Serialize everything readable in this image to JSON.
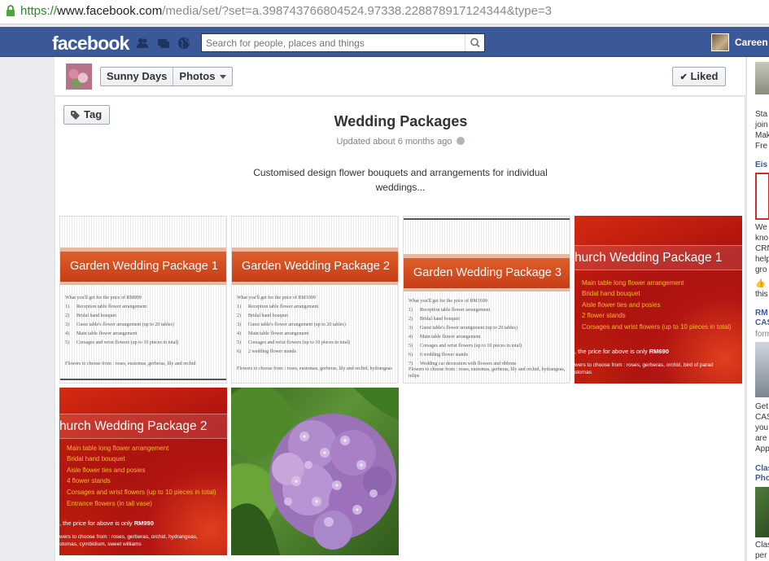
{
  "browser": {
    "url_https": "https://",
    "url_host": "www.facebook.com",
    "url_path": "/media/set/?set=a.398743766804524.97338.228878917124344&type=3"
  },
  "fb_header": {
    "logo": "facebook",
    "search_placeholder": "Search for people, places and things",
    "user_name": "Careen"
  },
  "page_strip": {
    "page_name": "Sunny Days",
    "section": "Photos",
    "liked_label": "Liked"
  },
  "album": {
    "tag_label": "Tag",
    "title": "Wedding Packages",
    "updated": "Updated about 6 months ago",
    "description": "Customised design flower bouquets and arrangements for individual weddings..."
  },
  "photos": {
    "garden1": {
      "title": "Garden Wedding Package 1",
      "intro": "What you'll get for the price of RM899",
      "items": [
        {
          "n": "1)",
          "t": "Reception table flower arrangement"
        },
        {
          "n": "2)",
          "t": "Bridal hand bouquet"
        },
        {
          "n": "3)",
          "t": "Guest table's flower arrangement (up to 20 tables)"
        },
        {
          "n": "4)",
          "t": "Main table flower arrangement"
        },
        {
          "n": "5)",
          "t": "Corsages and wrist flowers (up to 10 pieces in total)"
        }
      ],
      "flowers": "Flowers to choose from : roses, eustomas, gerberas, lily and orchid"
    },
    "garden2": {
      "title": "Garden Wedding Package 2",
      "intro": "What you'll get for the price of RM1099",
      "items": [
        {
          "n": "1)",
          "t": "Reception table flower arrangement"
        },
        {
          "n": "2)",
          "t": "Bridal hand bouquet"
        },
        {
          "n": "3)",
          "t": "Guest table's flower arrangement (up to 20 tables)"
        },
        {
          "n": "4)",
          "t": "Main table flower arrangement"
        },
        {
          "n": "5)",
          "t": "Corsages and wrist flowers (up to 10 pieces in total)"
        },
        {
          "n": "6)",
          "t": "2 wedding flower stands"
        }
      ],
      "flowers": "Flowers to choose from : roses, eustomas, gerberas, lily and orchid, hydrangeas"
    },
    "garden3": {
      "title": "Garden Wedding Package 3",
      "intro": "What you'll get for the price of RM1699",
      "items": [
        {
          "n": "1)",
          "t": "Reception table flower arrangement"
        },
        {
          "n": "2)",
          "t": "Bridal hand bouquet"
        },
        {
          "n": "3)",
          "t": "Guest table's flower arrangement (up to 20 tables)"
        },
        {
          "n": "4)",
          "t": "Main table flower arrangement"
        },
        {
          "n": "5)",
          "t": "Corsages and wrist flowers (up to 10 pieces in total)"
        },
        {
          "n": "6)",
          "t": "6 wedding flower stands"
        },
        {
          "n": "7)",
          "t": "Wedding car decoration with flowers and ribbons"
        }
      ],
      "flowers": "Flowers to choose from : roses, eustomas, gerberas, lily and orchid, hydrangeas, tulips"
    },
    "church1": {
      "title": "hurch Wedding Package 1",
      "items": [
        "Main table long flower arrangement",
        "Bridal hand bouquet",
        "Aisle flower ties and posies",
        "2 flower stands",
        "Corsages and wrist flowers (up to 10 pieces in total)"
      ],
      "price_text": ", the price for above is only ",
      "price": "RM690",
      "flowers_1": "wers to choose from : roses, gerberas, orchid, bird of parad",
      "flowers_2": "stomas"
    },
    "church2": {
      "title": "hurch Wedding Package 2",
      "items": [
        "Main table long flower arrangement",
        "Bridal hand bouquet",
        "Aisle flower ties and posies",
        "4 flower stands",
        "Corsages and wrist flowers (up to 10 pieces in total)",
        "Entrance flowers (in tall vase)"
      ],
      "price_text": ", the price for above is only ",
      "price": "RM990",
      "flowers_1": "wers to choose from : roses, gerberas, orchid, hydrangeas,",
      "flowers_2": "stomas, cymbidium, sweet williams"
    }
  },
  "right_rail": {
    "snippet_1": [
      "Sta",
      "join",
      "Mak",
      "Fre"
    ],
    "ad_2_title": "Eis",
    "snippet_2": [
      "We",
      "kno",
      "CRN",
      "help",
      "gro"
    ],
    "like_text": "this",
    "ad_3_title": [
      "RM",
      "CAS"
    ],
    "ad_3_sub": "form",
    "snippet_3": [
      "Get",
      "CAS",
      "you",
      "are",
      "App"
    ],
    "ad_4_title": [
      "Clas",
      "Pho"
    ],
    "snippet_4": [
      "Clas",
      "per"
    ]
  },
  "colors": {
    "facebook_blue": "#3b5998",
    "url_green": "#2a8a2a",
    "package_orange": "#d9522a",
    "church_red": "#b31612",
    "church_list_yellow": "#f7b733"
  }
}
